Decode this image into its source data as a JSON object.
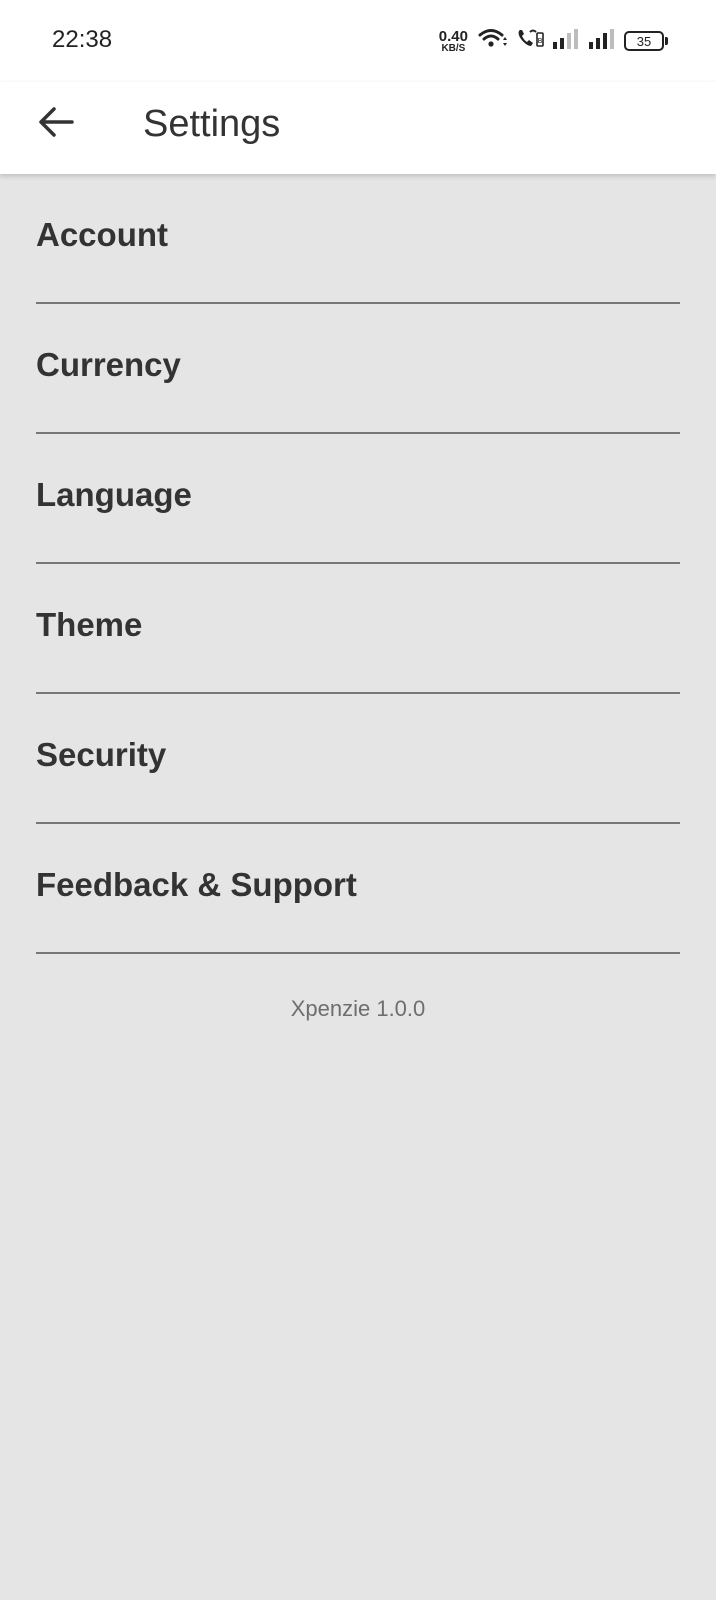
{
  "status_bar": {
    "time": "22:38",
    "net_speed_value": "0.40",
    "net_speed_unit": "KB/S",
    "battery_level": "35",
    "icons": [
      "wifi-icon",
      "volte-call-icon",
      "signal-sim1-icon",
      "signal-sim2-icon",
      "battery-icon"
    ]
  },
  "app_bar": {
    "back_icon": "arrow-left-icon",
    "title": "Settings"
  },
  "settings": {
    "items": [
      {
        "label": "Account"
      },
      {
        "label": "Currency"
      },
      {
        "label": "Language"
      },
      {
        "label": "Theme"
      },
      {
        "label": "Security"
      },
      {
        "label": "Feedback & Support"
      }
    ]
  },
  "footer": {
    "version": "Xpenzie 1.0.0"
  },
  "colors": {
    "background": "#e5e5e5",
    "surface": "#ffffff",
    "text": "#333333",
    "divider": "#777777",
    "muted_text": "#6e6e6e"
  }
}
